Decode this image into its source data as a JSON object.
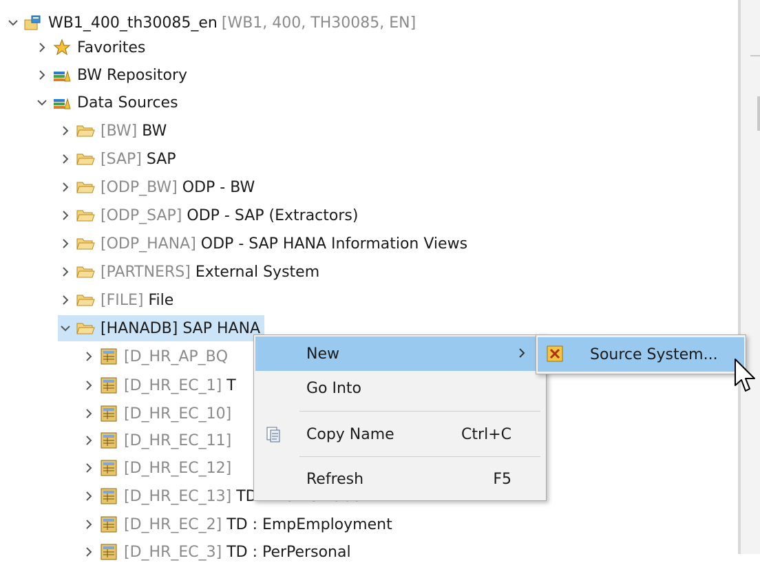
{
  "tree": {
    "root": {
      "name": "WB1_400_th30085_en",
      "meta": "[WB1, 400, TH30085, EN]"
    },
    "top_items": [
      {
        "label": "Favorites"
      },
      {
        "label": "BW Repository"
      },
      {
        "label": "Data Sources"
      }
    ],
    "folders": [
      {
        "tag": "[BW]",
        "name": "BW"
      },
      {
        "tag": "[SAP]",
        "name": "SAP"
      },
      {
        "tag": "[ODP_BW]",
        "name": "ODP - BW"
      },
      {
        "tag": "[ODP_SAP]",
        "name": "ODP - SAP (Extractors)"
      },
      {
        "tag": "[ODP_HANA]",
        "name": "ODP - SAP HANA Information Views"
      },
      {
        "tag": "[PARTNERS]",
        "name": "External System"
      },
      {
        "tag": "[FILE]",
        "name": "File"
      },
      {
        "tag": "[HANADB]",
        "name": "SAP HANA"
      }
    ],
    "tables": [
      {
        "tag": "[D_HR_AP_BQ",
        "name": ""
      },
      {
        "tag": "[D_HR_EC_1]",
        "name": "T"
      },
      {
        "tag": "[D_HR_EC_10]",
        "name": ""
      },
      {
        "tag": "[D_HR_EC_11]",
        "name": ""
      },
      {
        "tag": "[D_HR_EC_12]",
        "name": ""
      },
      {
        "tag": "[D_HR_EC_13]",
        "name": "TD : PicklistLabel"
      },
      {
        "tag": "[D_HR_EC_2]",
        "name": "TD : EmpEmployment"
      },
      {
        "tag": "[D_HR_EC_3]",
        "name": "TD : PerPersonal"
      }
    ]
  },
  "context_menu": {
    "items": [
      {
        "label": "New",
        "accelerator": "",
        "has_submenu": true,
        "icon": ""
      },
      {
        "label": "Go Into",
        "accelerator": "",
        "has_submenu": false,
        "icon": ""
      },
      {
        "label": "Copy Name",
        "accelerator": "Ctrl+C",
        "has_submenu": false,
        "icon": "clipboard-icon"
      },
      {
        "label": "Refresh",
        "accelerator": "F5",
        "has_submenu": false,
        "icon": ""
      }
    ],
    "submenu": {
      "label": "Source System...",
      "icon": "source-system-icon"
    }
  },
  "colors": {
    "selection": "#cce4f7",
    "menu_highlight": "#99c9ef",
    "folder": "#e9b949",
    "meta_gray": "#8a8a8a"
  }
}
